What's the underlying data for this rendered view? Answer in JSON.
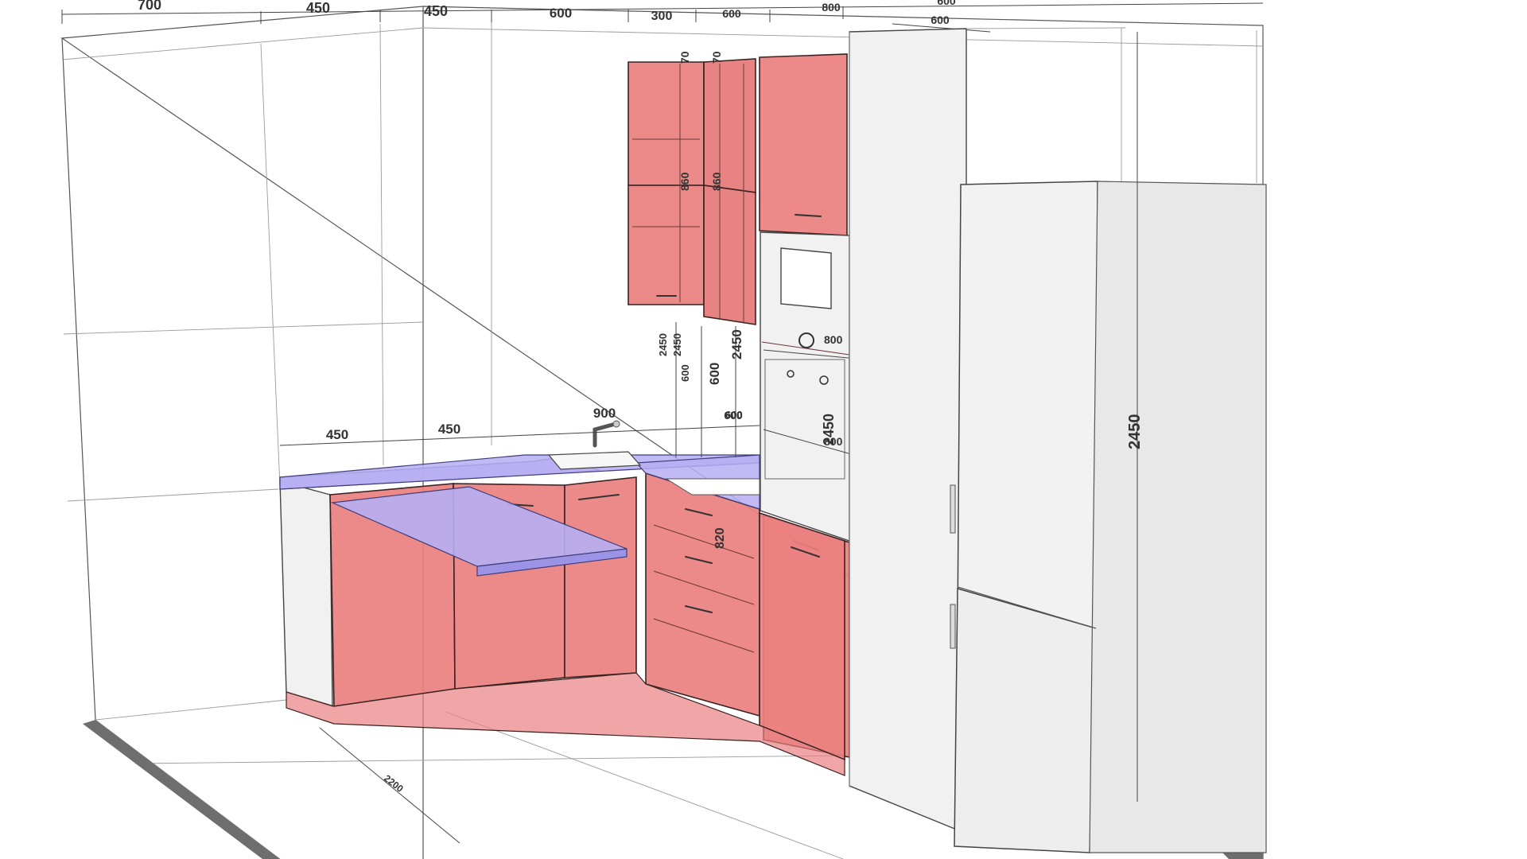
{
  "colors": {
    "cabinet_fill": "#ea8080",
    "cabinet_edge": "#3a2222",
    "countertop_fill": "#b6aef2",
    "appliance_fill": "#f1f1f1",
    "floor_edge": "#6e6e6e",
    "background": "#ffffff"
  },
  "dimensions": {
    "top_row": [
      "700",
      "450",
      "450",
      "600",
      "300",
      "600",
      "800",
      "600",
      "600"
    ],
    "upper_cabinets": {
      "height_a": "70",
      "height_b": "70",
      "door_a": "860",
      "door_b": "860",
      "vertical_a": "2450",
      "vertical_b": "2450",
      "vertical_c": "2450",
      "gap_a": "600",
      "gap_b": "600",
      "gap_c": "600"
    },
    "countertop": {
      "seg_1": "450",
      "seg_2": "450",
      "seg_3": "900",
      "corner": "600",
      "base_height": "820"
    },
    "tall_unit": {
      "microwave_width": "800",
      "oven_width": "800",
      "height": "2450"
    },
    "fridge_height": "2450",
    "floor_length": "2200"
  },
  "icons": {
    "faucet": "faucet-icon",
    "sink": "sink-icon",
    "microwave": "microwave-icon",
    "oven": "oven-icon",
    "fridge": "fridge-icon"
  }
}
